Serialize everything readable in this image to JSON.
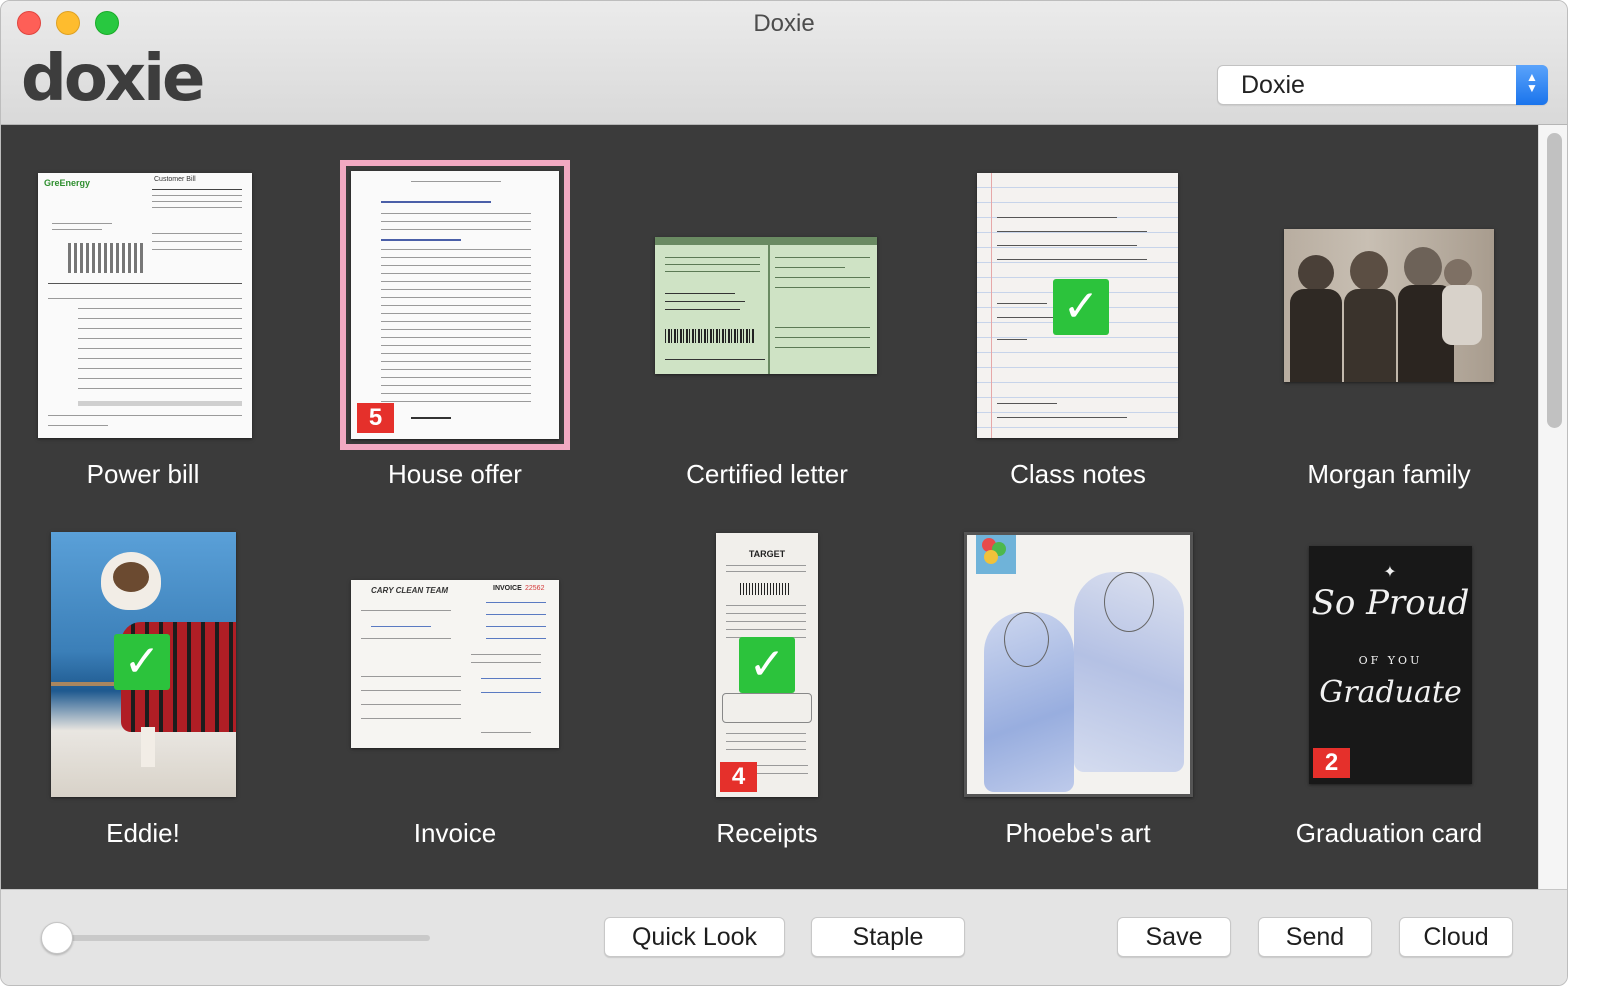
{
  "window": {
    "title": "Doxie"
  },
  "app": {
    "logo_text": "doxie"
  },
  "device_selector": {
    "value": "Doxie",
    "icon": "up-down-chevrons-icon"
  },
  "items": [
    {
      "label": "Power bill"
    },
    {
      "label": "House offer",
      "badge": "5",
      "selected": true
    },
    {
      "label": "Certified letter"
    },
    {
      "label": "Class notes",
      "checked": true
    },
    {
      "label": "Morgan family"
    },
    {
      "label": "Eddie!",
      "checked": true
    },
    {
      "label": "Invoice"
    },
    {
      "label": "Receipts",
      "badge": "4",
      "checked": true
    },
    {
      "label": "Phoebe's art"
    },
    {
      "label": "Graduation card",
      "badge": "2"
    }
  ],
  "thumb_text": {
    "power_bill_brand": "GreEnergy",
    "power_bill_header": "Customer Bill",
    "invoice_company": "CARY CLEAN TEAM",
    "invoice_title": "INVOICE",
    "invoice_number": "22562",
    "receipt_store": "TARGET",
    "grad_line1": "So Proud",
    "grad_line2": "OF YOU",
    "grad_line3": "Graduate"
  },
  "toolbar": {
    "quick_look": "Quick Look",
    "staple": "Staple",
    "save": "Save",
    "send": "Send",
    "cloud": "Cloud"
  },
  "zoom_slider": {
    "value": 0
  }
}
